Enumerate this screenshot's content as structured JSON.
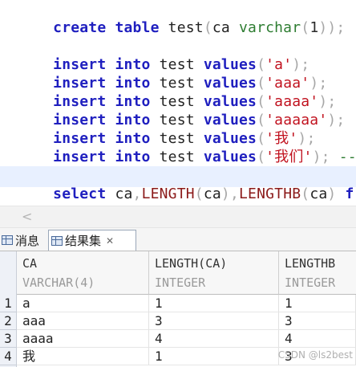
{
  "editor": {
    "lines": [
      {
        "k1": "create",
        "k2": "table",
        "id": "test",
        "p1": "(",
        "c": "ca",
        "ty": "varchar",
        "p2": "(",
        "n": "1",
        "p3": "));"
      },
      {
        "ins": "insert",
        "into": "into",
        "tbl": "test",
        "vals": "values",
        "lp": "(",
        "s": "'a'",
        "rp": ");",
        "cm": ""
      },
      {
        "ins": "insert",
        "into": "into",
        "tbl": "test",
        "vals": "values",
        "lp": "(",
        "s": "'aaa'",
        "rp": ");",
        "cm": ""
      },
      {
        "ins": "insert",
        "into": "into",
        "tbl": "test",
        "vals": "values",
        "lp": "(",
        "s": "'aaaa'",
        "rp": ");",
        "cm": ""
      },
      {
        "ins": "insert",
        "into": "into",
        "tbl": "test",
        "vals": "values",
        "lp": "(",
        "s": "'aaaaa'",
        "rp": ");",
        "cm": " --"
      },
      {
        "ins": "insert",
        "into": "into",
        "tbl": "test",
        "vals": "values",
        "lp": "(",
        "s": "'我'",
        "rp": ");",
        "cm": ""
      },
      {
        "ins": "insert",
        "into": "into",
        "tbl": "test",
        "vals": "values",
        "lp": "(",
        "s": "'我们'",
        "rp": ");",
        "cm": " -- 列"
      }
    ],
    "select_line": {
      "sel": "select",
      "ca": "ca",
      "c1": ",",
      "f1": "LENGTH",
      "o1": "(",
      "a1": "ca",
      "cl1": ")",
      "c2": ",",
      "f2": "LENGTHB",
      "o2": "(",
      "a2": "ca",
      "cl2": ")",
      "from": "fro"
    }
  },
  "scrollbar": {
    "left_arrow": "<"
  },
  "tabs": {
    "messages": "消息",
    "results": "结果集",
    "close": "✕"
  },
  "grid": {
    "columns": [
      {
        "name": "CA",
        "type": "VARCHAR(4)"
      },
      {
        "name": "LENGTH(CA)",
        "type": "INTEGER"
      },
      {
        "name": "LENGTHB",
        "type": "INTEGER"
      }
    ],
    "rows": [
      {
        "num": "1",
        "ca": "a",
        "length": "1",
        "lengthb": "1"
      },
      {
        "num": "2",
        "ca": "aaa",
        "length": "3",
        "lengthb": "3"
      },
      {
        "num": "3",
        "ca": "aaaa",
        "length": "4",
        "lengthb": "4"
      },
      {
        "num": "4",
        "ca": "我",
        "length": "1",
        "lengthb": "3"
      }
    ]
  },
  "watermark": "CSDN @ls2best"
}
